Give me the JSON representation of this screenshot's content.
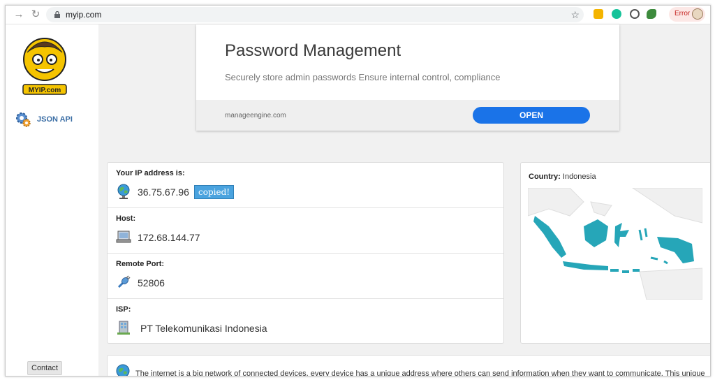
{
  "browser": {
    "url": "myip.com",
    "error_label": "Error"
  },
  "sidebar": {
    "logo_text": "MYIP.com",
    "api_label": "JSON API",
    "contact_label": "Contact"
  },
  "ad": {
    "title": "Password Management",
    "subtitle": "Securely store admin passwords Ensure internal control, compliance",
    "domain": "manageengine.com",
    "open_label": "OPEN"
  },
  "ip_info": {
    "rows": [
      {
        "label": "Your IP address is:",
        "value": "36.75.67.96",
        "badge": "copied!"
      },
      {
        "label": "Host:",
        "value": "172.68.144.77"
      },
      {
        "label": "Remote Port:",
        "value": "52806"
      },
      {
        "label": "ISP:",
        "value": "PT Telekomunikasi Indonesia"
      }
    ]
  },
  "country": {
    "label": "Country:",
    "value": "Indonesia"
  },
  "info": {
    "text": "The internet is a big network of connected devices, every device has a unique address where others can send information when they want to communicate. This unique"
  },
  "colors": {
    "map_fill": "#26a6b8",
    "button_blue": "#1a73e8",
    "badge_blue": "#4aa3df"
  }
}
